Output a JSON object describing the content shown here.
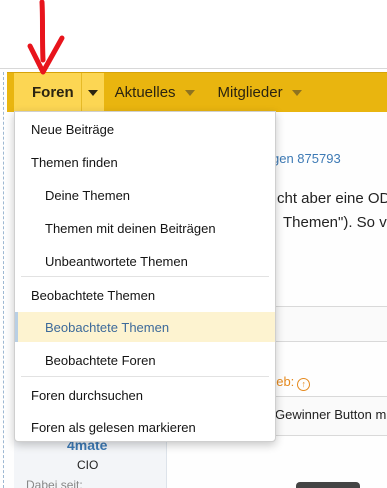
{
  "nav": {
    "tabs": [
      {
        "label": "Foren",
        "selected": true
      },
      {
        "label": "Aktuelles",
        "selected": false
      },
      {
        "label": "Mitglieder",
        "selected": false
      }
    ]
  },
  "dropdown": {
    "items": [
      {
        "label": "Neue Beiträge",
        "level": 1
      },
      {
        "label": "Themen finden",
        "level": 1
      },
      {
        "label": "Deine Themen",
        "level": 2
      },
      {
        "label": "Themen mit deinen Beiträgen",
        "level": 2
      },
      {
        "label": "Unbeantwortete Themen",
        "level": 2
      },
      {
        "label": "Beobachtete Themen",
        "level": 1
      },
      {
        "label": "Beobachtete Themen",
        "level": 2,
        "active": true
      },
      {
        "label": "Beobachtete Foren",
        "level": 2
      },
      {
        "label": "Foren durchsuchen",
        "level": 1
      },
      {
        "label": "Foren als gelesen markieren",
        "level": 1
      }
    ]
  },
  "background": {
    "thread_link": "gen 875793",
    "body_line1": "cht aber eine OD",
    "body_line2": "Themen\"). So v",
    "orange_text": "rieb:",
    "winner_text": "Gewinner Button m",
    "username": "4mate",
    "user_role": "CIO",
    "joined_label": "Dabei seit:"
  },
  "annotation": {
    "arrow_icon": "red-arrow-down-icon",
    "color": "#e8141c"
  },
  "colors": {
    "navbar": "#e9b50f",
    "nav_selected": "#fcd653",
    "menu_active_bg": "#fdf3d0",
    "menu_active_text": "#3d6a9a",
    "link": "#3d7ab5"
  }
}
